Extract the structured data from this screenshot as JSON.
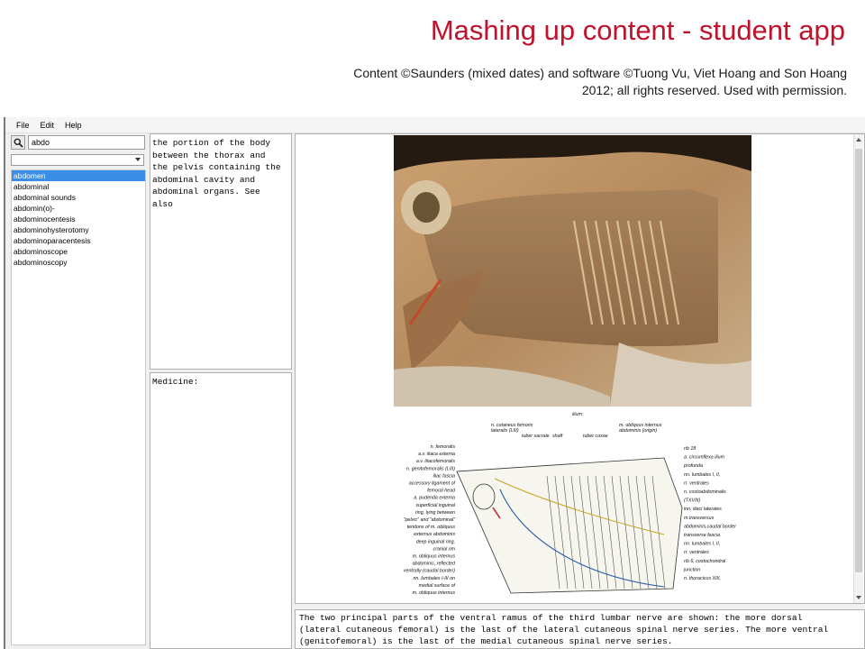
{
  "slide": {
    "title": "Mashing up content - student app",
    "credit": "Content ©Saunders (mixed dates) and software ©Tuong Vu, Viet Hoang and Son Hoang 2012; all rights reserved. Used with permission."
  },
  "menu": {
    "file": "File",
    "edit": "Edit",
    "help": "Help"
  },
  "search": {
    "icon": "search-icon",
    "value": "abdo"
  },
  "word_list": [
    {
      "label": "abdomen",
      "selected": true
    },
    {
      "label": "abdominal"
    },
    {
      "label": "abdominal sounds"
    },
    {
      "label": "abdomin(o)-"
    },
    {
      "label": "abdominocentesis"
    },
    {
      "label": "abdominohysterotomy"
    },
    {
      "label": "abdominoparacentesis"
    },
    {
      "label": "abdominoscope"
    },
    {
      "label": "abdominoscopy"
    }
  ],
  "definition": "the portion of the body\nbetween the thorax and\nthe pelvis containing the\nabdominal cavity and\nabdominal organs. See\nalso",
  "medicine_label": "Medicine:",
  "diagram": {
    "top_labels": [
      "ilium:",
      "n. cutaneus femoris",
      "lateralis (LIII)",
      "tuber sacrale",
      "shaft",
      "tuber coxae",
      "m. obliquus internus",
      "abdominis (origin)"
    ],
    "left_labels": [
      "n. femoralis",
      "a.v. iliaca externa",
      "a.v. iliacofemoralis",
      "n. genitofemoralis (LIII)",
      "iliac fascia",
      "accessory ligament of",
      "femoral head",
      "a. pudenda externa",
      "superficial inguinal",
      "ring, lying between",
      "\"pelvic\" and \"abdominal\"",
      "tendons of m. obliquus",
      "externus abdominis",
      "deep inguinal ring,",
      "cranial rim",
      "m. obliquus internus",
      "abdominis, reflected",
      "ventrally (caudal border)",
      "nn. lumbales I-III on",
      "medial surface of",
      "m. obliquus internus"
    ],
    "right_labels": [
      "rib 18",
      "a. circumflexa ilium",
      "profunda",
      "nn. lumbales I, II,",
      "rr. ventrales",
      "n. costoabdominalis",
      "(TXVIII)",
      "lnn. iliaci laterales",
      "m.transversus",
      "abdominis,caudal border",
      "transverse fascia",
      "nn. lumbales I, II,",
      "rr. ventrales",
      "rib 6, costochondral",
      "junction",
      "n. thoracicus XIII,"
    ]
  },
  "caption": [
    "The two principal parts of the ventral ramus of the third lumbar nerve are shown: the more dorsal",
    "(lateral cutaneous femoral) is the last of the lateral cutaneous spinal nerve series. The more ventral",
    "(genitofemoral) is the last of the medial cutaneous spinal nerve series."
  ],
  "colors": {
    "title": "#c0122a",
    "selection": "#3a8ee6"
  }
}
